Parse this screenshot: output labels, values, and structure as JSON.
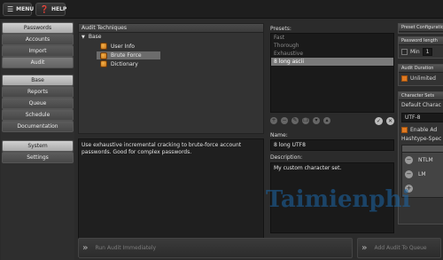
{
  "toolbar": {
    "menu_label": "MENU",
    "help_label": "HELP"
  },
  "sidebar": {
    "group1": [
      "Passwords",
      "Accounts",
      "Import",
      "Audit"
    ],
    "group2": [
      "Base",
      "Reports",
      "Queue",
      "Schedule",
      "Documentation"
    ],
    "group3": [
      "System",
      "Settings"
    ]
  },
  "audit": {
    "title": "Audit Techniques",
    "root": "Base",
    "items": [
      "User Info",
      "Brute Force",
      "Dictionary"
    ],
    "description": "Use exhaustive incremental cracking to brute-force account passwords. Good for complex passwords."
  },
  "presets": {
    "label": "Presets:",
    "items": [
      "Fast",
      "Thorough",
      "Exhaustive",
      "8 long ascii"
    ],
    "name_label": "Name:",
    "name_value": "8 long UTF8",
    "desc_label": "Description:",
    "desc_value": "My custom character set."
  },
  "config": {
    "title": "Preset Configuration",
    "password_length": "Password length",
    "min": "Min",
    "min_value": "1",
    "audit_duration": "Audit Duration",
    "unlimited": "Unlimited",
    "char_sets": "Character Sets",
    "default_char": "Default Charac",
    "encoding": "UTF-8",
    "enable": "Enable Ad",
    "hashtype": "Hashtype-Spec",
    "hash_rows": [
      "NTLM",
      "LM"
    ]
  },
  "actions": {
    "run": "Run Audit Immediately",
    "queue": "Add Audit To Queue"
  },
  "watermark": "Taimienphi"
}
